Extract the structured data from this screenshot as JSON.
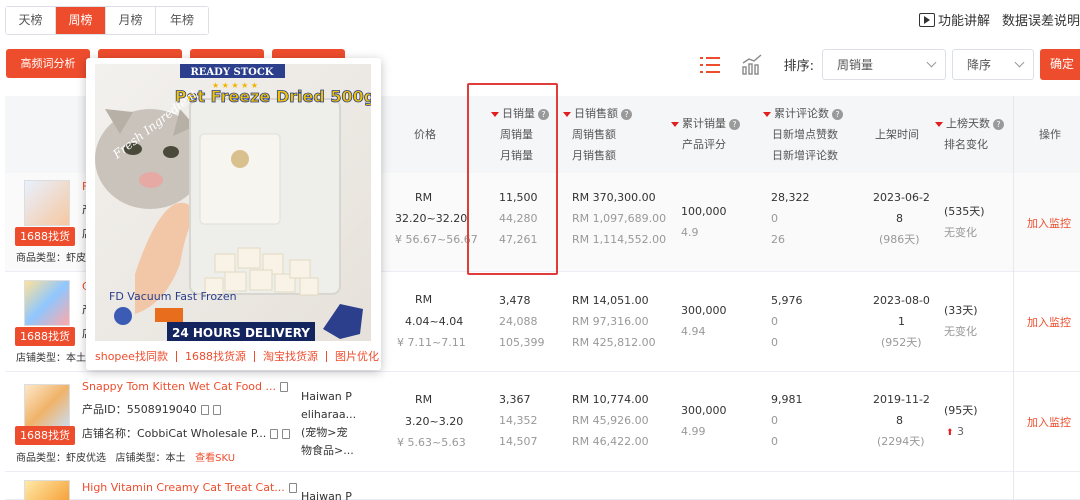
{
  "tabs": [
    "天榜",
    "周榜",
    "月榜",
    "年榜"
  ],
  "active_tab": 1,
  "top_links": {
    "features": "功能讲解",
    "data_error": "数据误差说明"
  },
  "toolbar": {
    "keyword_analysis": "高频词分析"
  },
  "sort": {
    "label": "排序:",
    "field": "周销量",
    "order": "降序",
    "confirm": "确定"
  },
  "headers": {
    "price": "价格",
    "daily_sales": "日销量",
    "weekly_sales": "周销量",
    "monthly_sales": "月销量",
    "daily_revenue": "日销售额",
    "weekly_revenue": "周销售额",
    "monthly_revenue": "月销售额",
    "total_sales": "累计销量",
    "rating": "产品评分",
    "total_reviews": "累计评论数",
    "new_likes": "日新增点赞数",
    "new_reviews": "日新增评论数",
    "listing_time": "上架时间",
    "days_on_list": "上榜天数",
    "rank_change": "排名变化",
    "action": "操作"
  },
  "rows": [
    {
      "title": "F",
      "line2": "产",
      "line3": "店",
      "category": "商品类型：虾皮",
      "tag": "1688找货源",
      "price_local": "RM",
      "price_range": "32.20~32.20",
      "price_cny": "¥ 56.67~56.67",
      "daily_sales": "11,500",
      "weekly_sales": "44,280",
      "monthly_sales": "47,261",
      "daily_revenue": "RM 370,300.00",
      "weekly_revenue": "RM 1,097,689.00",
      "monthly_revenue": "RM 1,114,552.00",
      "total_sales": "100,000",
      "rating": "4.9",
      "total_reviews": "28,322",
      "new_likes": "0",
      "new_reviews": "26",
      "listing_line1": "2023-06-2",
      "listing_line2": "8",
      "listing_days": "(986天)",
      "days_on_list": "(535天)",
      "rank_change": "无变化",
      "action": "加入监控"
    },
    {
      "title": "C",
      "line2": "产",
      "line3": "店",
      "category": "店铺类型：本土",
      "tag": "1688找货源",
      "price_local": "RM",
      "price_range": "4.04~4.04",
      "price_cny": "¥ 7.11~7.11",
      "daily_sales": "3,478",
      "weekly_sales": "24,088",
      "monthly_sales": "105,399",
      "daily_revenue": "RM 14,051.00",
      "weekly_revenue": "RM 97,316.00",
      "monthly_revenue": "RM 425,812.00",
      "total_sales": "300,000",
      "rating": "4.94",
      "total_reviews": "5,976",
      "new_likes": "0",
      "new_reviews": "0",
      "listing_line1": "2023-08-0",
      "listing_line2": "1",
      "listing_days": "(952天)",
      "days_on_list": "(33天)",
      "rank_change": "无变化",
      "action": "加入监控"
    },
    {
      "title": "Snappy Tom Kitten Wet Cat Food ...",
      "line2": "产品ID：5508919040",
      "line3": "店铺名称：CobbiCat Wholesale P...",
      "category": "商品类型：虾皮优选",
      "shop_type": "店铺类型：本土",
      "view_sku": "查看SKU",
      "tag": "1688找货源",
      "seller_1": "Haiwan P",
      "seller_2": "eliharaa...",
      "seller_3": "(宠物>宠",
      "seller_4": "物食品>...",
      "price_local": "RM",
      "price_range": "3.20~3.20",
      "price_cny": "¥ 5.63~5.63",
      "daily_sales": "3,367",
      "weekly_sales": "14,352",
      "monthly_sales": "14,507",
      "daily_revenue": "RM 10,774.00",
      "weekly_revenue": "RM 45,926.00",
      "monthly_revenue": "RM 46,422.00",
      "total_sales": "300,000",
      "rating": "4.99",
      "total_reviews": "9,981",
      "new_likes": "0",
      "new_reviews": "0",
      "listing_line1": "2019-11-2",
      "listing_line2": "8",
      "listing_days": "(2294天)",
      "days_on_list": "(95天)",
      "rank_change": "3",
      "action": "加入监控"
    },
    {
      "title": "High Vitamin Creamy Cat Treat Cat...",
      "seller_1": "Haiwan P"
    }
  ],
  "popup": {
    "banner": "READY STOCK",
    "product_name": "Pet Freeze Dried 500g",
    "side_text": "Fresh Ingredient",
    "tech_text": "FD Vacuum Fast Frozen",
    "delivery": "24 HOURS DELIVERY",
    "links": [
      "shopee找同款",
      "1688找货源",
      "淘宝找货源",
      "图片优化"
    ]
  },
  "colors": {
    "accent": "#ee4d2d",
    "highlight": "#e03c3c",
    "rank_up": "#e02020"
  }
}
